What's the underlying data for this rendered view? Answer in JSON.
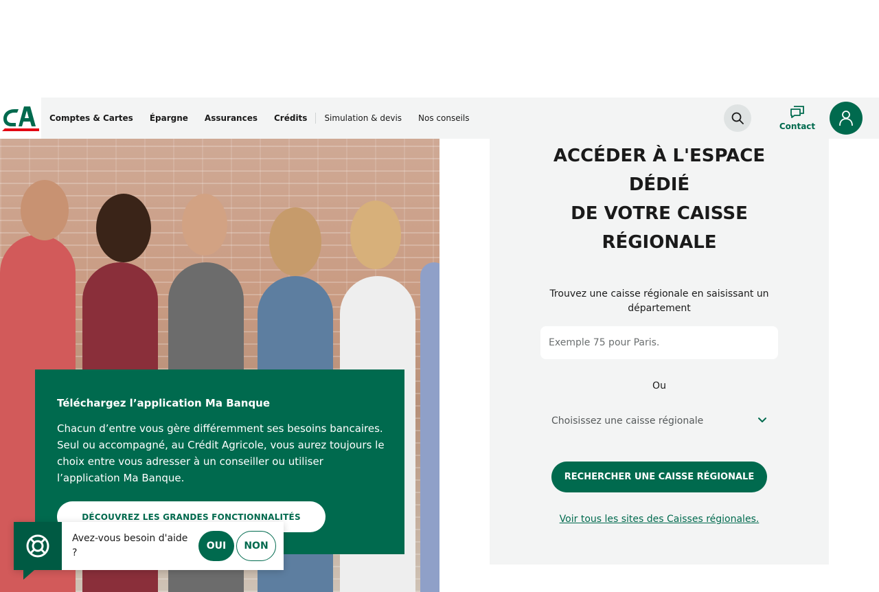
{
  "nav": {
    "items": [
      {
        "label": "Comptes & Cartes"
      },
      {
        "label": "Épargne"
      },
      {
        "label": "Assurances"
      },
      {
        "label": "Crédits"
      }
    ],
    "secondary": [
      {
        "label": "Simulation & devis"
      },
      {
        "label": "Nos conseils"
      }
    ],
    "contact_label": "Contact"
  },
  "promo": {
    "title": "Téléchargez l’application Ma Banque",
    "text": "Chacun d’entre vous gère différemment ses besoins bancaires. Seul ou accompagné, au Crédit Agricole, vous aurez toujours le choix entre vous adresser à un conseiller ou utiliser l’application Ma Banque.",
    "cta": "DÉCOUVREZ LES GRANDES FONCTIONNALITÉS"
  },
  "help": {
    "question": "Avez-vous besoin d'aide ?",
    "yes": "OUI",
    "no": "NON"
  },
  "panel": {
    "title_line1": "ACCÉDER À L'ESPACE",
    "title_line2": "DÉDIÉ",
    "title_line3": "DE VOTRE CAISSE",
    "title_line4": "RÉGIONALE",
    "subtitle": "Trouvez une caisse régionale en saisissant un département",
    "input_placeholder": "Exemple 75 pour Paris.",
    "input_value": "",
    "or": "Ou",
    "select_value": "Choisissez une caisse régionale",
    "cta": "RECHERCHER UNE CAISSE RÉGIONALE",
    "link": "Voir tous les sites des Caisses régionales."
  },
  "colors": {
    "brand_green": "#006a4e",
    "logo_red": "#e30613",
    "nav_bg": "#f3f4f4"
  }
}
